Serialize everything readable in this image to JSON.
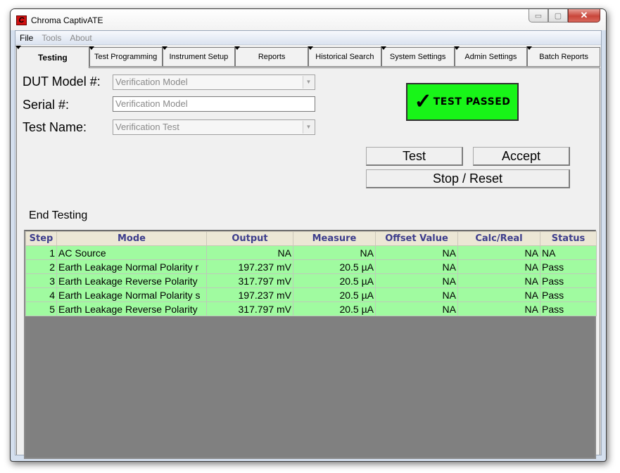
{
  "window": {
    "title": "Chroma CaptivATE",
    "app_icon": "chroma-logo-icon",
    "controls": {
      "minimize": "minimize-icon",
      "maximize": "maximize-icon",
      "close": "close-icon"
    },
    "control_glyphs": {
      "minimize": "▭",
      "maximize": "▢",
      "close": "✕"
    }
  },
  "menu": [
    {
      "label": "File",
      "enabled": true
    },
    {
      "label": "Tools",
      "enabled": false
    },
    {
      "label": "About",
      "enabled": false
    }
  ],
  "tabs": [
    {
      "label": "Testing",
      "active": true
    },
    {
      "label": "Test  Programming",
      "active": false
    },
    {
      "label": "Instrument Setup",
      "active": false
    },
    {
      "label": "Reports",
      "active": false
    },
    {
      "label": "Historical  Search",
      "active": false
    },
    {
      "label": "System Settings",
      "active": false
    },
    {
      "label": "Admin Settings",
      "active": false
    },
    {
      "label": "Batch Reports",
      "active": false
    }
  ],
  "form": {
    "dut_model": {
      "label": "DUT Model #:",
      "value": "Verification Model"
    },
    "serial": {
      "label": "Serial #:",
      "value": "Verification Model"
    },
    "test_name": {
      "label": "Test Name:",
      "value": "Verification Test"
    },
    "dropdown_glyph": "▼"
  },
  "status_banner": {
    "icon": "check-icon",
    "glyph": "✓",
    "text": "TEST PASSED",
    "color": "#18f518"
  },
  "buttons": {
    "test": "Test",
    "accept": "Accept",
    "stop_reset": "Stop / Reset"
  },
  "section_label": "End Testing",
  "results_table": {
    "columns": [
      "Step",
      "Mode",
      "Output",
      "Measure",
      "Offset Value",
      "Calc/Real",
      "Status"
    ],
    "rows": [
      [
        "1",
        "AC Source",
        "NA",
        "NA",
        "NA",
        "NA",
        "NA"
      ],
      [
        "2",
        "Earth Leakage Normal Polarity r",
        "197.237 mV",
        "20.5 µA",
        "NA",
        "NA",
        "Pass"
      ],
      [
        "3",
        "Earth Leakage Reverse Polarity",
        "317.797 mV",
        "20.5 µA",
        "NA",
        "NA",
        "Pass"
      ],
      [
        "4",
        "Earth Leakage Normal Polarity s",
        "197.237 mV",
        "20.5 µA",
        "NA",
        "NA",
        "Pass"
      ],
      [
        "5",
        "Earth Leakage Reverse Polarity",
        "317.797 mV",
        "20.5 µA",
        "NA",
        "NA",
        "Pass"
      ]
    ],
    "row_color": "#a0fba0",
    "header_color": "#ece7d5"
  }
}
